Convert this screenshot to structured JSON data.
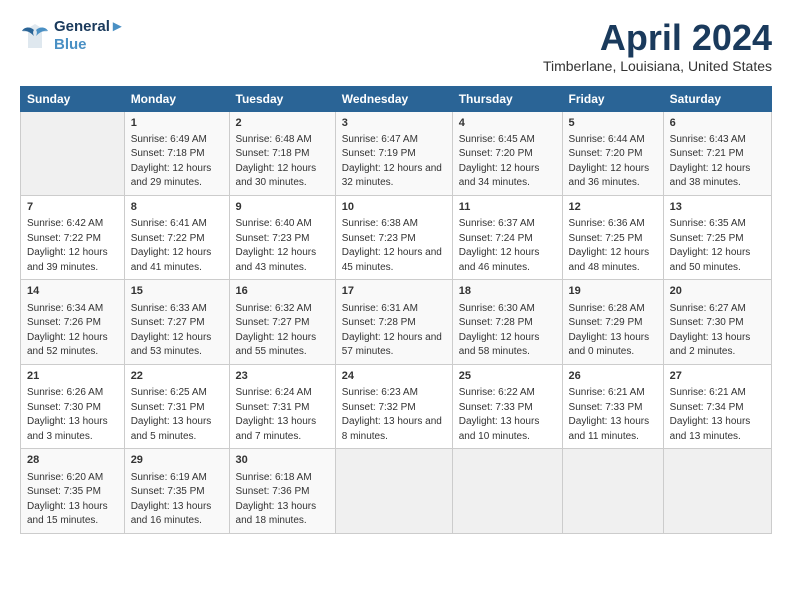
{
  "logo": {
    "line1": "General",
    "line2": "Blue"
  },
  "title": "April 2024",
  "subtitle": "Timberlane, Louisiana, United States",
  "days_of_week": [
    "Sunday",
    "Monday",
    "Tuesday",
    "Wednesday",
    "Thursday",
    "Friday",
    "Saturday"
  ],
  "weeks": [
    [
      {
        "day": "",
        "empty": true
      },
      {
        "day": "1",
        "sunrise": "6:49 AM",
        "sunset": "7:18 PM",
        "daylight": "12 hours and 29 minutes."
      },
      {
        "day": "2",
        "sunrise": "6:48 AM",
        "sunset": "7:18 PM",
        "daylight": "12 hours and 30 minutes."
      },
      {
        "day": "3",
        "sunrise": "6:47 AM",
        "sunset": "7:19 PM",
        "daylight": "12 hours and 32 minutes."
      },
      {
        "day": "4",
        "sunrise": "6:45 AM",
        "sunset": "7:20 PM",
        "daylight": "12 hours and 34 minutes."
      },
      {
        "day": "5",
        "sunrise": "6:44 AM",
        "sunset": "7:20 PM",
        "daylight": "12 hours and 36 minutes."
      },
      {
        "day": "6",
        "sunrise": "6:43 AM",
        "sunset": "7:21 PM",
        "daylight": "12 hours and 38 minutes."
      }
    ],
    [
      {
        "day": "7",
        "sunrise": "6:42 AM",
        "sunset": "7:22 PM",
        "daylight": "12 hours and 39 minutes."
      },
      {
        "day": "8",
        "sunrise": "6:41 AM",
        "sunset": "7:22 PM",
        "daylight": "12 hours and 41 minutes."
      },
      {
        "day": "9",
        "sunrise": "6:40 AM",
        "sunset": "7:23 PM",
        "daylight": "12 hours and 43 minutes."
      },
      {
        "day": "10",
        "sunrise": "6:38 AM",
        "sunset": "7:23 PM",
        "daylight": "12 hours and 45 minutes."
      },
      {
        "day": "11",
        "sunrise": "6:37 AM",
        "sunset": "7:24 PM",
        "daylight": "12 hours and 46 minutes."
      },
      {
        "day": "12",
        "sunrise": "6:36 AM",
        "sunset": "7:25 PM",
        "daylight": "12 hours and 48 minutes."
      },
      {
        "day": "13",
        "sunrise": "6:35 AM",
        "sunset": "7:25 PM",
        "daylight": "12 hours and 50 minutes."
      }
    ],
    [
      {
        "day": "14",
        "sunrise": "6:34 AM",
        "sunset": "7:26 PM",
        "daylight": "12 hours and 52 minutes."
      },
      {
        "day": "15",
        "sunrise": "6:33 AM",
        "sunset": "7:27 PM",
        "daylight": "12 hours and 53 minutes."
      },
      {
        "day": "16",
        "sunrise": "6:32 AM",
        "sunset": "7:27 PM",
        "daylight": "12 hours and 55 minutes."
      },
      {
        "day": "17",
        "sunrise": "6:31 AM",
        "sunset": "7:28 PM",
        "daylight": "12 hours and 57 minutes."
      },
      {
        "day": "18",
        "sunrise": "6:30 AM",
        "sunset": "7:28 PM",
        "daylight": "12 hours and 58 minutes."
      },
      {
        "day": "19",
        "sunrise": "6:28 AM",
        "sunset": "7:29 PM",
        "daylight": "13 hours and 0 minutes."
      },
      {
        "day": "20",
        "sunrise": "6:27 AM",
        "sunset": "7:30 PM",
        "daylight": "13 hours and 2 minutes."
      }
    ],
    [
      {
        "day": "21",
        "sunrise": "6:26 AM",
        "sunset": "7:30 PM",
        "daylight": "13 hours and 3 minutes."
      },
      {
        "day": "22",
        "sunrise": "6:25 AM",
        "sunset": "7:31 PM",
        "daylight": "13 hours and 5 minutes."
      },
      {
        "day": "23",
        "sunrise": "6:24 AM",
        "sunset": "7:31 PM",
        "daylight": "13 hours and 7 minutes."
      },
      {
        "day": "24",
        "sunrise": "6:23 AM",
        "sunset": "7:32 PM",
        "daylight": "13 hours and 8 minutes."
      },
      {
        "day": "25",
        "sunrise": "6:22 AM",
        "sunset": "7:33 PM",
        "daylight": "13 hours and 10 minutes."
      },
      {
        "day": "26",
        "sunrise": "6:21 AM",
        "sunset": "7:33 PM",
        "daylight": "13 hours and 11 minutes."
      },
      {
        "day": "27",
        "sunrise": "6:21 AM",
        "sunset": "7:34 PM",
        "daylight": "13 hours and 13 minutes."
      }
    ],
    [
      {
        "day": "28",
        "sunrise": "6:20 AM",
        "sunset": "7:35 PM",
        "daylight": "13 hours and 15 minutes."
      },
      {
        "day": "29",
        "sunrise": "6:19 AM",
        "sunset": "7:35 PM",
        "daylight": "13 hours and 16 minutes."
      },
      {
        "day": "30",
        "sunrise": "6:18 AM",
        "sunset": "7:36 PM",
        "daylight": "13 hours and 18 minutes."
      },
      {
        "day": "",
        "empty": true
      },
      {
        "day": "",
        "empty": true
      },
      {
        "day": "",
        "empty": true
      },
      {
        "day": "",
        "empty": true
      }
    ]
  ]
}
